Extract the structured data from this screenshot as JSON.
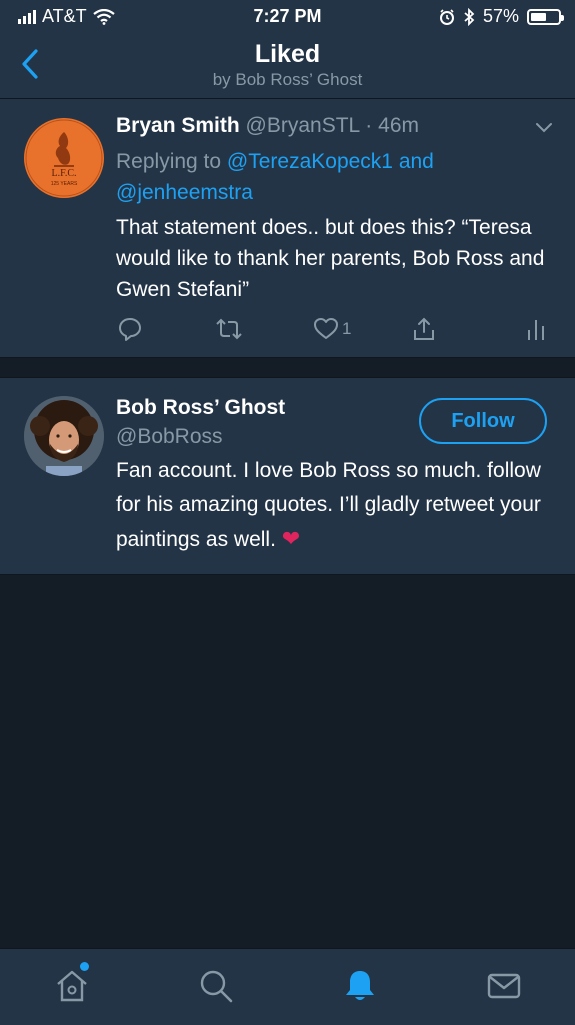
{
  "status_bar": {
    "carrier": "AT&T",
    "time": "7:27 PM",
    "battery_percent_label": "57%",
    "battery_level": 0.57
  },
  "nav": {
    "title": "Liked",
    "subtitle": "by Bob Ross’ Ghost"
  },
  "tweet": {
    "author_name": "Bryan Smith",
    "author_handle": "@BryanSTL",
    "separator": " · ",
    "time_ago": "46m",
    "replying_prefix": "Replying to",
    "replying_mentions": "@TerezaKopeck1 and @jenheemstra",
    "text": "That statement does.. but does this? “Teresa would like to thank her parents, Bob Ross and Gwen Stefani”",
    "like_count": "1",
    "avatar_logo_text": "L.F.C.",
    "avatar_logo_subtext": "125 YEARS"
  },
  "profile": {
    "name": "Bob Ross’ Ghost",
    "handle": "@BobRoss",
    "follow_label": "Follow",
    "bio": "Fan account. I love Bob Ross so much. follow for his amazing quotes. I’ll gladly retweet your paintings as well. ",
    "bio_emoji": "❤"
  },
  "colors": {
    "accent": "#1da1f2",
    "background": "#141d26",
    "card": "#243447",
    "muted_text": "#8899a6",
    "liverpool_orange": "#e8722b"
  },
  "icons": [
    "back-icon",
    "chevron-down-icon",
    "reply-icon",
    "retweet-icon",
    "like-icon",
    "share-icon",
    "analytics-icon",
    "home-icon",
    "search-icon",
    "notifications-icon",
    "messages-icon"
  ]
}
